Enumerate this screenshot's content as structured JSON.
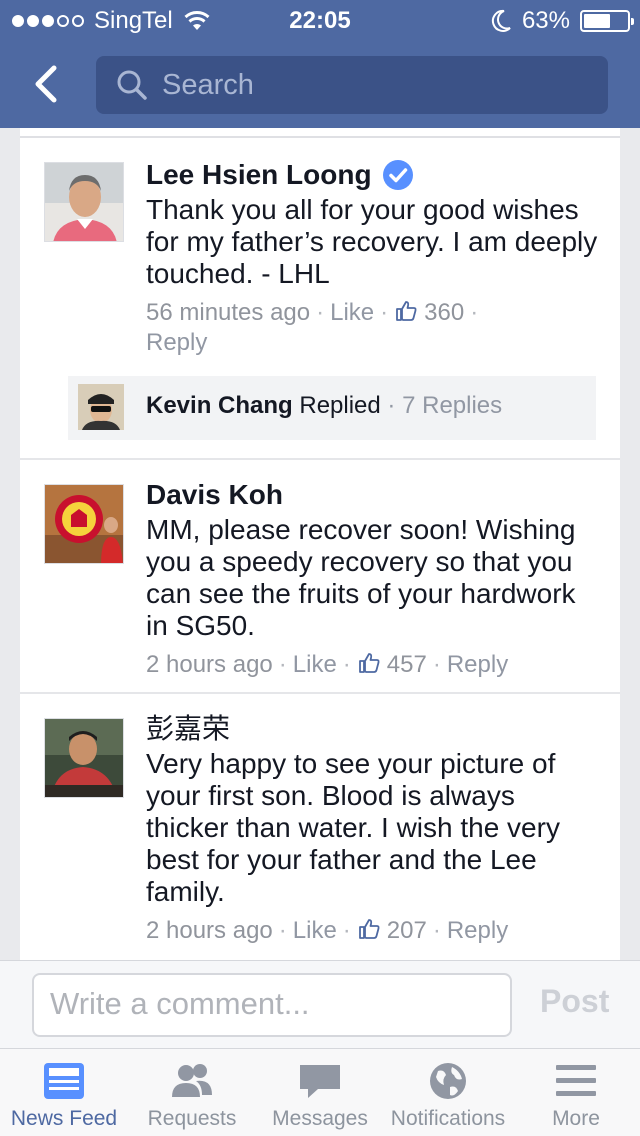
{
  "status_bar": {
    "carrier": "SingTel",
    "time": "22:05",
    "battery": "63%",
    "battery_level": 0.63
  },
  "nav": {
    "search_placeholder": "Search"
  },
  "comments": [
    {
      "name": "Lee Hsien Loong",
      "verified": true,
      "text": "Thank you all for your good wishes for my father’s recovery. I am deeply touched. - LHL",
      "time": "56 minutes ago",
      "like": "Like",
      "likes": "360",
      "reply": "Reply"
    },
    {
      "name": "Davis Koh",
      "text": "MM, please recover soon! Wishing you a speedy recovery so that you can see the fruits of your hardwork in SG50.",
      "time": "2 hours ago",
      "like": "Like",
      "likes": "457",
      "reply": "Reply"
    },
    {
      "name": "彭嘉荣",
      "text": "Very happy to see your picture of your first son. Blood is always thicker than water. I wish the very best for your father and the Lee family.",
      "time": "2 hours ago",
      "like": "Like",
      "likes": "207",
      "reply": "Reply"
    }
  ],
  "reply_summary": {
    "name": "Kevin Chang",
    "action": "Replied",
    "count": "7 Replies"
  },
  "composer": {
    "placeholder": "Write a comment...",
    "post_label": "Post"
  },
  "tabs": [
    {
      "label": "News Feed",
      "icon": "news-feed-icon",
      "active": true
    },
    {
      "label": "Requests",
      "icon": "friend-requests-icon"
    },
    {
      "label": "Messages",
      "icon": "messages-icon"
    },
    {
      "label": "Notifications",
      "icon": "globe-icon"
    },
    {
      "label": "More",
      "icon": "menu-icon"
    }
  ],
  "colors": {
    "brand": "#4e69a2",
    "verified": "#5890ff"
  }
}
